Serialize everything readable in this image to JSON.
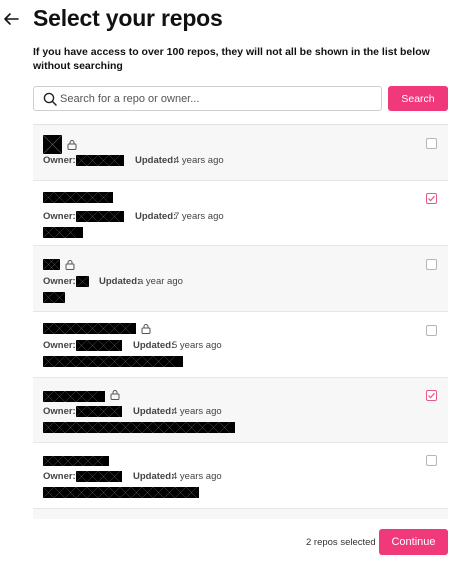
{
  "header": {
    "title": "Select your repos",
    "back_icon": "arrow-left-icon"
  },
  "notice": "If you have access to over 100 repos, they will not all be shown in the list below without searching",
  "search": {
    "placeholder": "Search for a repo or owner...",
    "value": "",
    "button_label": "Search",
    "icon": "search-icon"
  },
  "repos": [
    {
      "name": "[redacted]",
      "private": true,
      "owner_label": "Owner:",
      "owner": "[redacted]",
      "updated_label": "Updated:",
      "updated": "4 years ago",
      "description": "",
      "selected": false
    },
    {
      "name": "[redacted]",
      "private": false,
      "owner_label": "Owner:",
      "owner": "[redacted]",
      "updated_label": "Updated:",
      "updated": "7 years ago",
      "description": "[redacted]",
      "selected": true
    },
    {
      "name": "[redacted]",
      "private": true,
      "owner_label": "Owner:",
      "owner": "[redacted]",
      "updated_label": "Updated:",
      "updated": "a year ago",
      "description": "[redacted]",
      "selected": false
    },
    {
      "name": "[redacted]",
      "private": true,
      "owner_label": "Owner:",
      "owner": "[redacted]",
      "updated_label": "Updated:",
      "updated": "5 years ago",
      "description": "[redacted]",
      "selected": false
    },
    {
      "name": "[redacted]",
      "private": true,
      "owner_label": "Owner:",
      "owner": "[redacted]",
      "updated_label": "Updated:",
      "updated": "4 years ago",
      "description": "[redacted]",
      "selected": true
    },
    {
      "name": "[redacted]",
      "private": false,
      "owner_label": "Owner:",
      "owner": "[redacted]",
      "updated_label": "Updated:",
      "updated": "4 years ago",
      "description": "[redacted]",
      "selected": false
    }
  ],
  "footer": {
    "selected_text": "2 repos selected",
    "continue_label": "Continue"
  },
  "colors": {
    "accent": "#f0397a",
    "checkbox_checked": "#e25b86"
  }
}
